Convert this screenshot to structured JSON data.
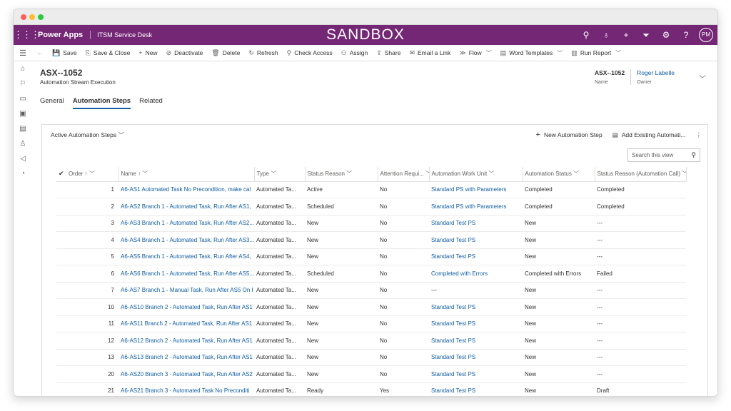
{
  "app": {
    "name": "Power Apps",
    "subtitle": "ITSM Service Desk",
    "banner": "SANDBOX",
    "avatar": "PM"
  },
  "commands": [
    {
      "icon": "💾",
      "label": "Save"
    },
    {
      "icon": "⎘",
      "label": "Save & Close"
    },
    {
      "icon": "+",
      "label": "New"
    },
    {
      "icon": "⊘",
      "label": "Deactivate"
    },
    {
      "icon": "🗑",
      "label": "Delete"
    },
    {
      "icon": "↻",
      "label": "Refresh"
    },
    {
      "icon": "⚲",
      "label": "Check Access"
    },
    {
      "icon": "⚇",
      "label": "Assign"
    },
    {
      "icon": "⇪",
      "label": "Share"
    },
    {
      "icon": "✉",
      "label": "Email a Link"
    },
    {
      "icon": "≫",
      "label": "Flow"
    },
    {
      "icon": "▤",
      "label": "Word Templates"
    },
    {
      "icon": "▥",
      "label": "Run Report"
    }
  ],
  "record": {
    "title": "ASX--1052",
    "type": "Automation Stream Execution",
    "name_value": "ASX--1052",
    "name_label": "Name",
    "owner_value": "Roger Labelle",
    "owner_label": "Owner"
  },
  "tabs": [
    "General",
    "Automation Steps",
    "Related"
  ],
  "grid": {
    "view_title": "Active Automation Steps",
    "new_label": "New Automation Step",
    "add_existing_label": "Add Existing Automati...",
    "search_placeholder": "Search this view",
    "columns": [
      "Order ↑",
      "Name ↑",
      "Type",
      "Status Reason",
      "Attention Requi...",
      "Automation Work Unit",
      "Automation Status",
      "Status Reason (Automation Call)"
    ],
    "rows": [
      [
        "1",
        "A6-AS1 Automated Task No Precondition, make cal",
        "Automated Ta...",
        "Active",
        "No",
        "Standard PS with Parameters",
        "Completed",
        "Completed"
      ],
      [
        "2",
        "A6-AS2 Branch 1 - Automated Task, Run After AS1,",
        "Automated Ta...",
        "Scheduled",
        "No",
        "Standard PS with Parameters",
        "Completed",
        "Completed"
      ],
      [
        "3",
        "A6-AS3 Branch 1 - Automated Task, Run After AS2...",
        "Automated Ta...",
        "New",
        "No",
        "Standard Test PS",
        "New",
        "---"
      ],
      [
        "4",
        "A6-AS4 Branch 1 - Automated Task, Run After AS3...",
        "Automated Ta...",
        "New",
        "No",
        "Standard Test PS",
        "New",
        "---"
      ],
      [
        "5",
        "A6-AS5 Branch 1 - Automated Task, Run After AS4,",
        "Automated Ta...",
        "New",
        "No",
        "Standard Test PS",
        "New",
        "---"
      ],
      [
        "6",
        "A6-AS6 Branch 1 - Automated Task, Run After AS5...",
        "Automated Ta...",
        "Scheduled",
        "No",
        "Completed with Errors",
        "Completed with Errors",
        "Failed"
      ],
      [
        "7",
        "A6-AS7 Branch 1 - Manual Task, Run After AS5 On I",
        "Automated Ta...",
        "New",
        "No",
        "---",
        "New",
        "---"
      ],
      [
        "10",
        "A6-AS10 Branch 2 - Automated Task, Run After AS1",
        "Automated Ta...",
        "New",
        "No",
        "Standard Test PS",
        "New",
        "---"
      ],
      [
        "11",
        "A6-AS11 Branch 2 - Automated Task, Run After AS1",
        "Automated Ta...",
        "New",
        "No",
        "Standard Test PS",
        "New",
        "---"
      ],
      [
        "12",
        "A6-AS12 Branch 2 - Automated Task, Run After AS1",
        "Automated Ta...",
        "New",
        "No",
        "Standard Test PS",
        "New",
        "---"
      ],
      [
        "13",
        "A6-AS13 Branch 2 - Automated Task, Run After AS1",
        "Automated Ta...",
        "New",
        "No",
        "Standard Test PS",
        "New",
        "---"
      ],
      [
        "20",
        "A6-AS20 Branch 3 - Automated Task, Run After AS2",
        "Automated Ta...",
        "New",
        "No",
        "Standard Test PS",
        "New",
        "---"
      ],
      [
        "21",
        "A6-AS21 Branch 3 - Automated Task No Preconditi",
        "Automated Ta...",
        "Ready",
        "Yes",
        "Standard Test PS",
        "New",
        "Draft"
      ]
    ]
  }
}
